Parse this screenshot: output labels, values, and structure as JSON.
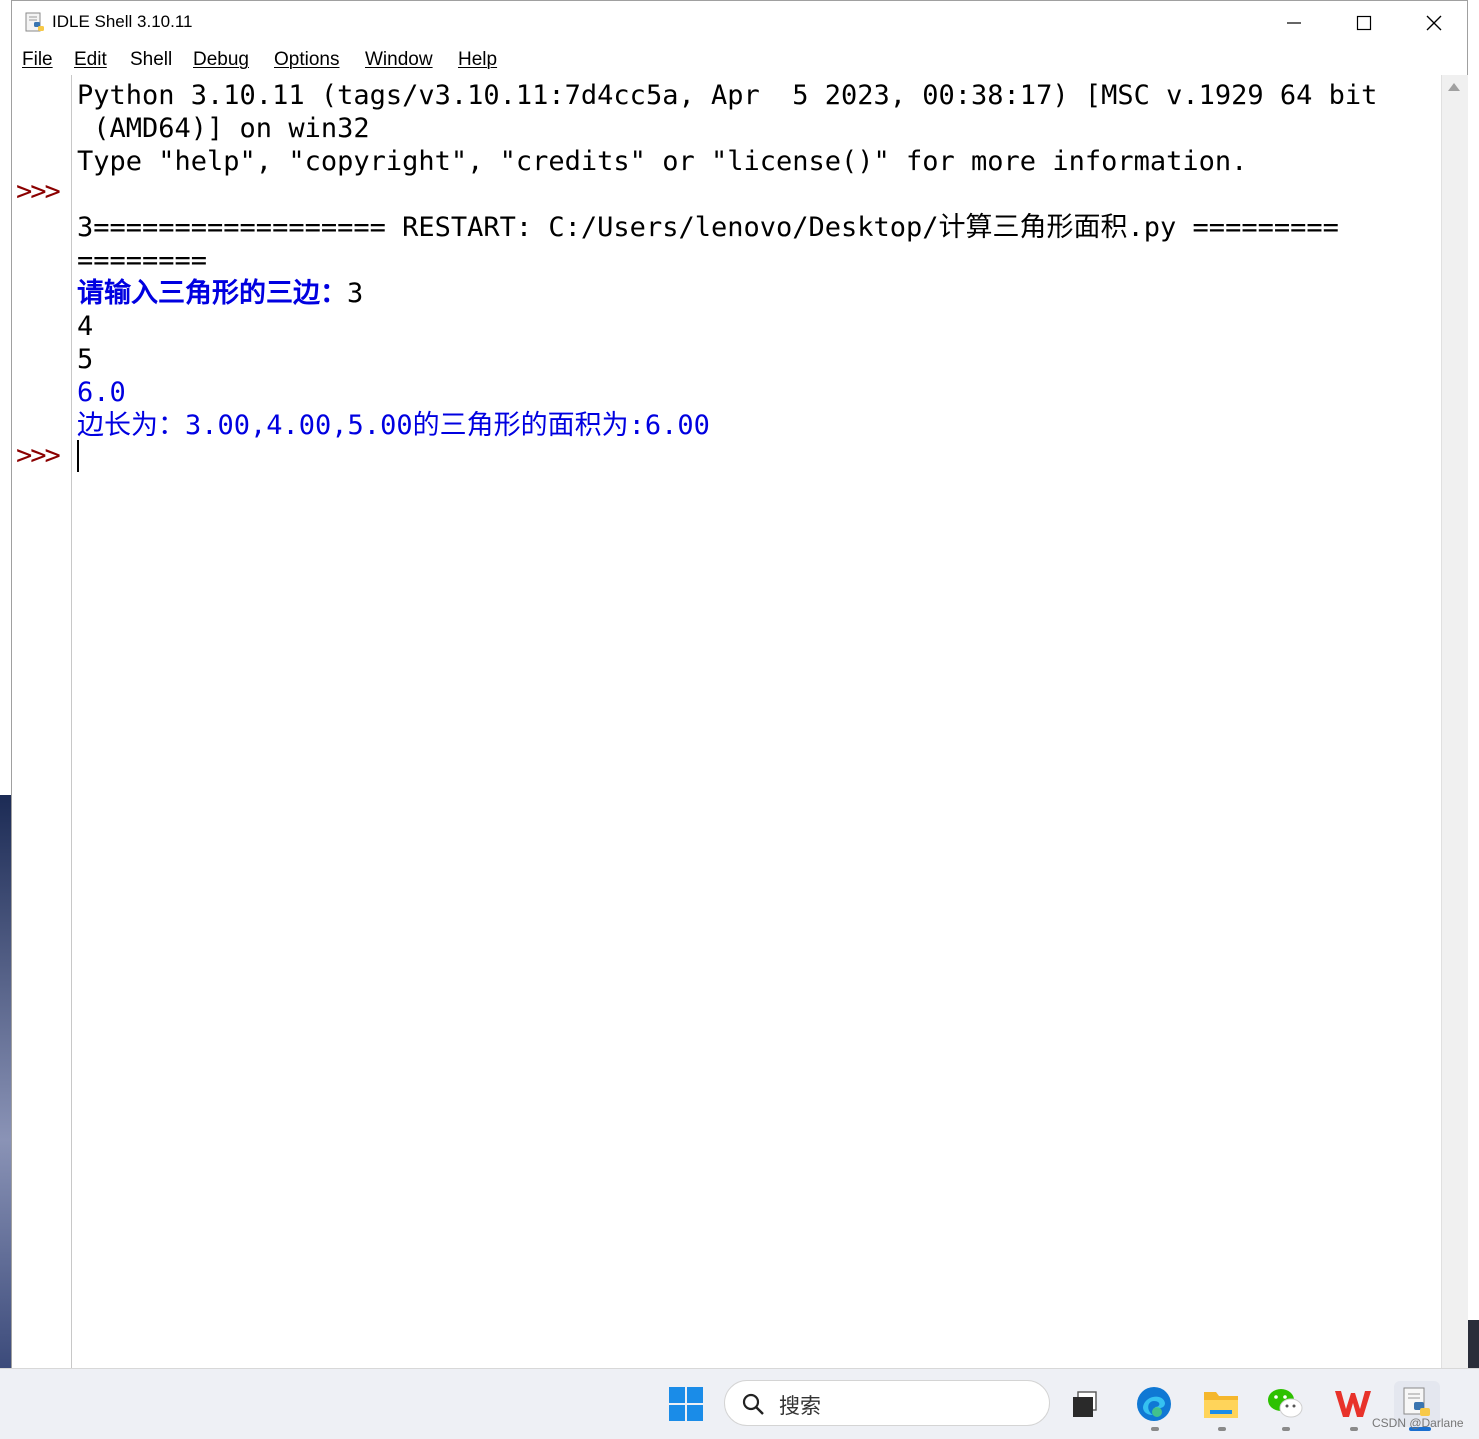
{
  "window": {
    "title": "IDLE Shell 3.10.11"
  },
  "menu": {
    "items": [
      {
        "label": "File",
        "mnemonic": "F",
        "rest": "ile"
      },
      {
        "label": "Edit",
        "mnemonic": "E",
        "rest": "dit"
      },
      {
        "label": "Shell",
        "mnemonic": "",
        "rest": "Shell"
      },
      {
        "label": "Debug",
        "mnemonic": "D",
        "rest": "ebug"
      },
      {
        "label": "Options",
        "mnemonic": "O",
        "rest": "ptions"
      },
      {
        "label": "Window",
        "mnemonic": "W",
        "rest": "indow"
      },
      {
        "label": "Help",
        "mnemonic": "H",
        "rest": "elp"
      }
    ]
  },
  "shell": {
    "prompt": ">>>",
    "lines": [
      {
        "text": "Python 3.10.11 (tags/v3.10.11:7d4cc5a, Apr  5 2023, 00:38:17) [MSC v.1929 64 bit",
        "style": "output"
      },
      {
        "text": " (AMD64)] on win32",
        "style": "output"
      },
      {
        "text": "Type \"help\", \"copyright\", \"credits\" or \"license()\" for more information.",
        "style": "output"
      },
      {
        "text": "",
        "style": "output"
      },
      {
        "text": "3================== RESTART: C:/Users/lenovo/Desktop/计算三角形面积.py =========",
        "style": "output"
      },
      {
        "text": "========",
        "style": "output"
      },
      {
        "text": "请输入三角形的三边：",
        "style": "stdout",
        "input": "3"
      },
      {
        "text": "4",
        "style": "input"
      },
      {
        "text": "5",
        "style": "input"
      },
      {
        "text": "6.0",
        "style": "stdout"
      },
      {
        "text": "边长为：3.00,4.00,5.00的三角形的面积为:6.00",
        "style": "stdout"
      }
    ]
  },
  "taskbar": {
    "search_placeholder": "搜索",
    "watermark": "CSDN @Darlane",
    "icons": [
      "windows-start-icon",
      "search-icon",
      "task-view-icon",
      "edge-icon",
      "file-explorer-icon",
      "wechat-icon",
      "wps-icon",
      "python-idle-icon"
    ]
  },
  "colors": {
    "prompt": "#8b0000",
    "stdout": "#0000e0",
    "text": "#000000"
  }
}
